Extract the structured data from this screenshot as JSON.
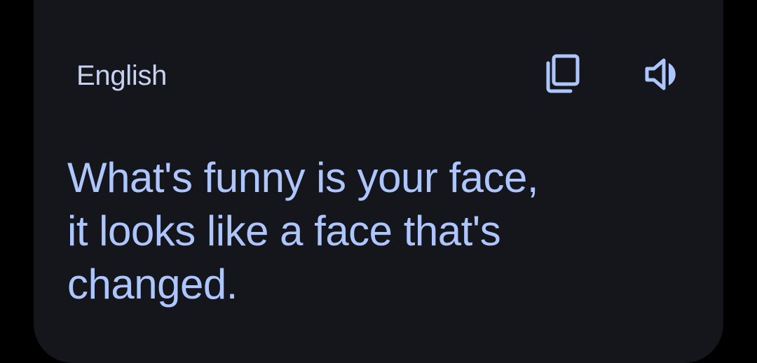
{
  "translation_card": {
    "language_label": "English",
    "translated_text": "What's funny is your face,\nit looks like a face that's\nchanged.",
    "actions": {
      "copy_icon": "copy-icon",
      "speak_icon": "speaker-icon"
    }
  },
  "colors": {
    "card_background": "#15161b",
    "label_color": "#c7d2ef",
    "text_color": "#aec6ff",
    "icon_color": "#aec6ff"
  }
}
